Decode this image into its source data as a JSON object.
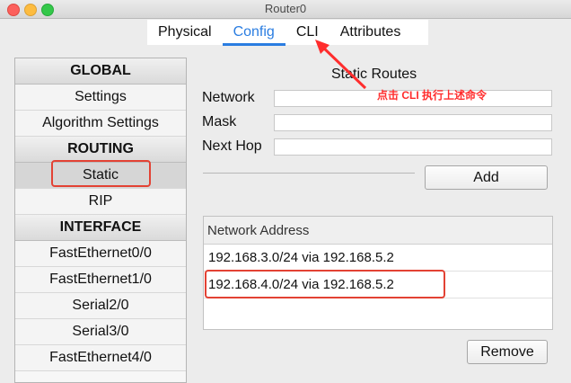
{
  "window": {
    "title": "Router0"
  },
  "tabs": [
    {
      "label": "Physical"
    },
    {
      "label": "Config"
    },
    {
      "label": "CLI"
    },
    {
      "label": "Attributes"
    }
  ],
  "active_tab": "Config",
  "sidebar": {
    "items": [
      {
        "label": "GLOBAL",
        "kind": "header"
      },
      {
        "label": "Settings",
        "kind": "item"
      },
      {
        "label": "Algorithm Settings",
        "kind": "item"
      },
      {
        "label": "ROUTING",
        "kind": "header"
      },
      {
        "label": "Static",
        "kind": "item",
        "selected": true
      },
      {
        "label": "RIP",
        "kind": "item"
      },
      {
        "label": "INTERFACE",
        "kind": "header"
      },
      {
        "label": "FastEthernet0/0",
        "kind": "item"
      },
      {
        "label": "FastEthernet1/0",
        "kind": "item"
      },
      {
        "label": "Serial2/0",
        "kind": "item"
      },
      {
        "label": "Serial3/0",
        "kind": "item"
      },
      {
        "label": "FastEthernet4/0",
        "kind": "item"
      }
    ]
  },
  "static_routes": {
    "title": "Static Routes",
    "network_label": "Network",
    "network_value": "",
    "mask_label": "Mask",
    "mask_value": "",
    "next_hop_label": "Next Hop",
    "next_hop_value": "",
    "add_label": "Add",
    "list_header": "Network Address",
    "routes": [
      "192.168.3.0/24 via 192.168.5.2",
      "192.168.4.0/24 via 192.168.5.2"
    ],
    "remove_label": "Remove"
  },
  "annotation": {
    "text": "点击 CLI 执行上述命令"
  },
  "colors": {
    "accent": "#2a7de1",
    "highlight": "#e34234",
    "annotation": "#ff2d2d"
  }
}
